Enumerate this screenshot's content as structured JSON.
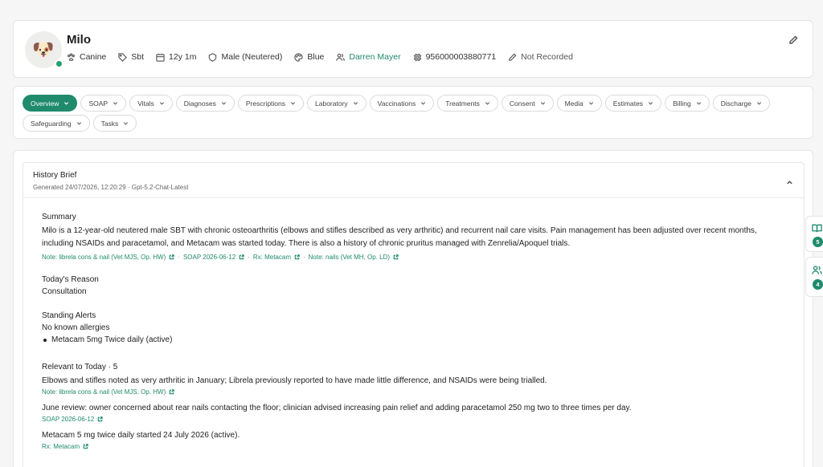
{
  "patient": {
    "name": "Milo",
    "avatar_icon": "dog-face-icon",
    "status_color": "#23a26b",
    "species": "Canine",
    "breed": "Sbt",
    "age": "12y 1m",
    "sex": "Male (Neutered)",
    "colour": "Blue",
    "owner": "Darren Mayer",
    "microchip": "956000003880771",
    "notes_status": "Not Recorded"
  },
  "tabs": [
    {
      "label": "Overview",
      "active": true
    },
    {
      "label": "SOAP"
    },
    {
      "label": "Vitals"
    },
    {
      "label": "Diagnoses"
    },
    {
      "label": "Prescriptions"
    },
    {
      "label": "Laboratory"
    },
    {
      "label": "Vaccinations"
    },
    {
      "label": "Treatments"
    },
    {
      "label": "Consent"
    },
    {
      "label": "Media"
    },
    {
      "label": "Estimates"
    },
    {
      "label": "Billing"
    },
    {
      "label": "Discharge"
    },
    {
      "label": "Safeguarding"
    },
    {
      "label": "Tasks"
    }
  ],
  "brief": {
    "title": "History Brief",
    "subtitle": "Generated 24/07/2026, 12:20:29 · Gpt-5.2-Chat-Latest",
    "summary": {
      "heading": "Summary",
      "text": "Milo is a 12-year-old neutered male SBT with chronic osteoarthritis (elbows and stifles described as very arthritic) and recurrent nail care visits. Pain management has been adjusted over recent months, including NSAIDs and paracetamol, and Metacam was started today. There is also a history of chronic pruritus managed with Zenrelia/Apoquel trials.",
      "refs": [
        "Note: librela cons & nail (Vet MJS, Op. HW)",
        "SOAP 2026-06-12",
        "Rx: Metacam",
        "Note: nails (Vet MH, Op. LD)"
      ]
    },
    "reason": {
      "heading": "Today's Reason",
      "text": "Consultation"
    },
    "alerts": {
      "heading": "Standing Alerts",
      "text": "No known allergies",
      "items": [
        "Metacam 5mg Twice daily (active)"
      ]
    },
    "relevant": {
      "heading": "Relevant to Today · 5",
      "items": [
        {
          "text": "Elbows and stifles noted as very arthritic in January; Librela previously reported to have made little difference, and NSAIDs were being trialled.",
          "ref": "Note: librela cons & nail (Vet MJS, Op. HW)"
        },
        {
          "text": "June review: owner concerned about rear nails contacting the floor; clinician advised increasing pain relief and adding paracetamol 250 mg two to three times per day.",
          "ref": "SOAP 2026-06-12"
        },
        {
          "text": "Metacam 5 mg twice daily started 24 July 2026 (active).",
          "ref": "Rx: Metacam"
        }
      ]
    }
  },
  "rail": {
    "knowledge_count": "5",
    "people_count": "4",
    "accent": "#1f8a6c"
  }
}
